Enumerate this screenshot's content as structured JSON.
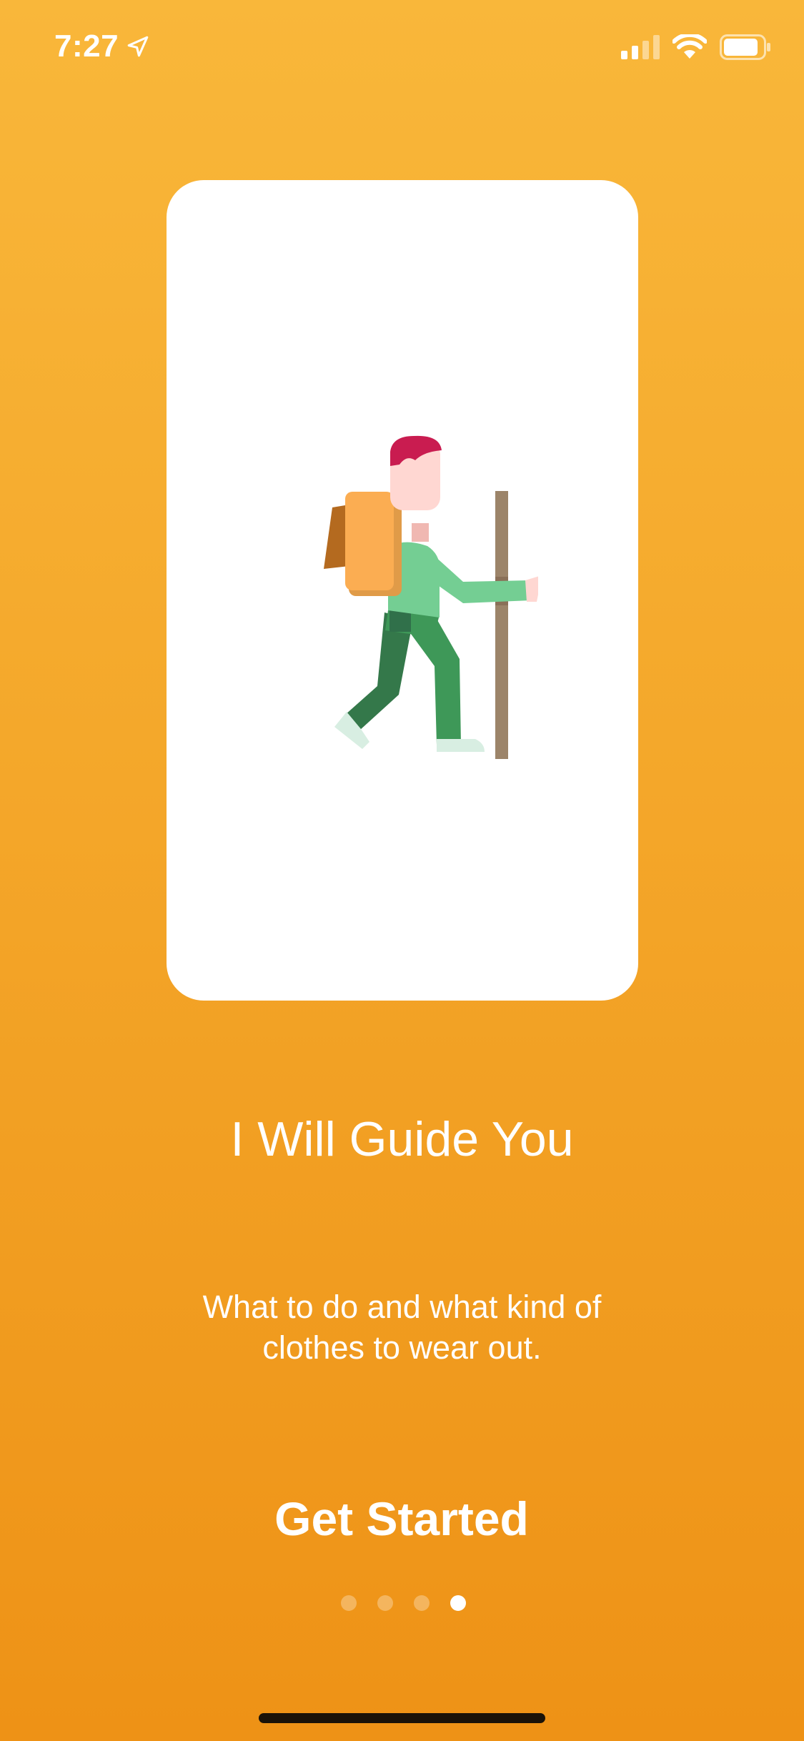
{
  "status_bar": {
    "time": "7:27",
    "location_icon": "location-arrow-icon",
    "signal_icon": "cellular-signal-icon",
    "wifi_icon": "wifi-icon",
    "battery_icon": "battery-icon"
  },
  "card": {
    "illustration": "hiker-with-walking-stick-illustration"
  },
  "onboarding": {
    "title": "I Will Guide You",
    "subtitle_line1": "What to do and what kind of",
    "subtitle_line2": "clothes to wear out.",
    "cta_label": "Get Started"
  },
  "pagination": {
    "total_pages": 4,
    "current_page": 4
  },
  "colors": {
    "background_top": "#F9B73A",
    "background_bottom": "#EE9216",
    "card": "#FFFFFF",
    "text": "#FFFFFF"
  }
}
